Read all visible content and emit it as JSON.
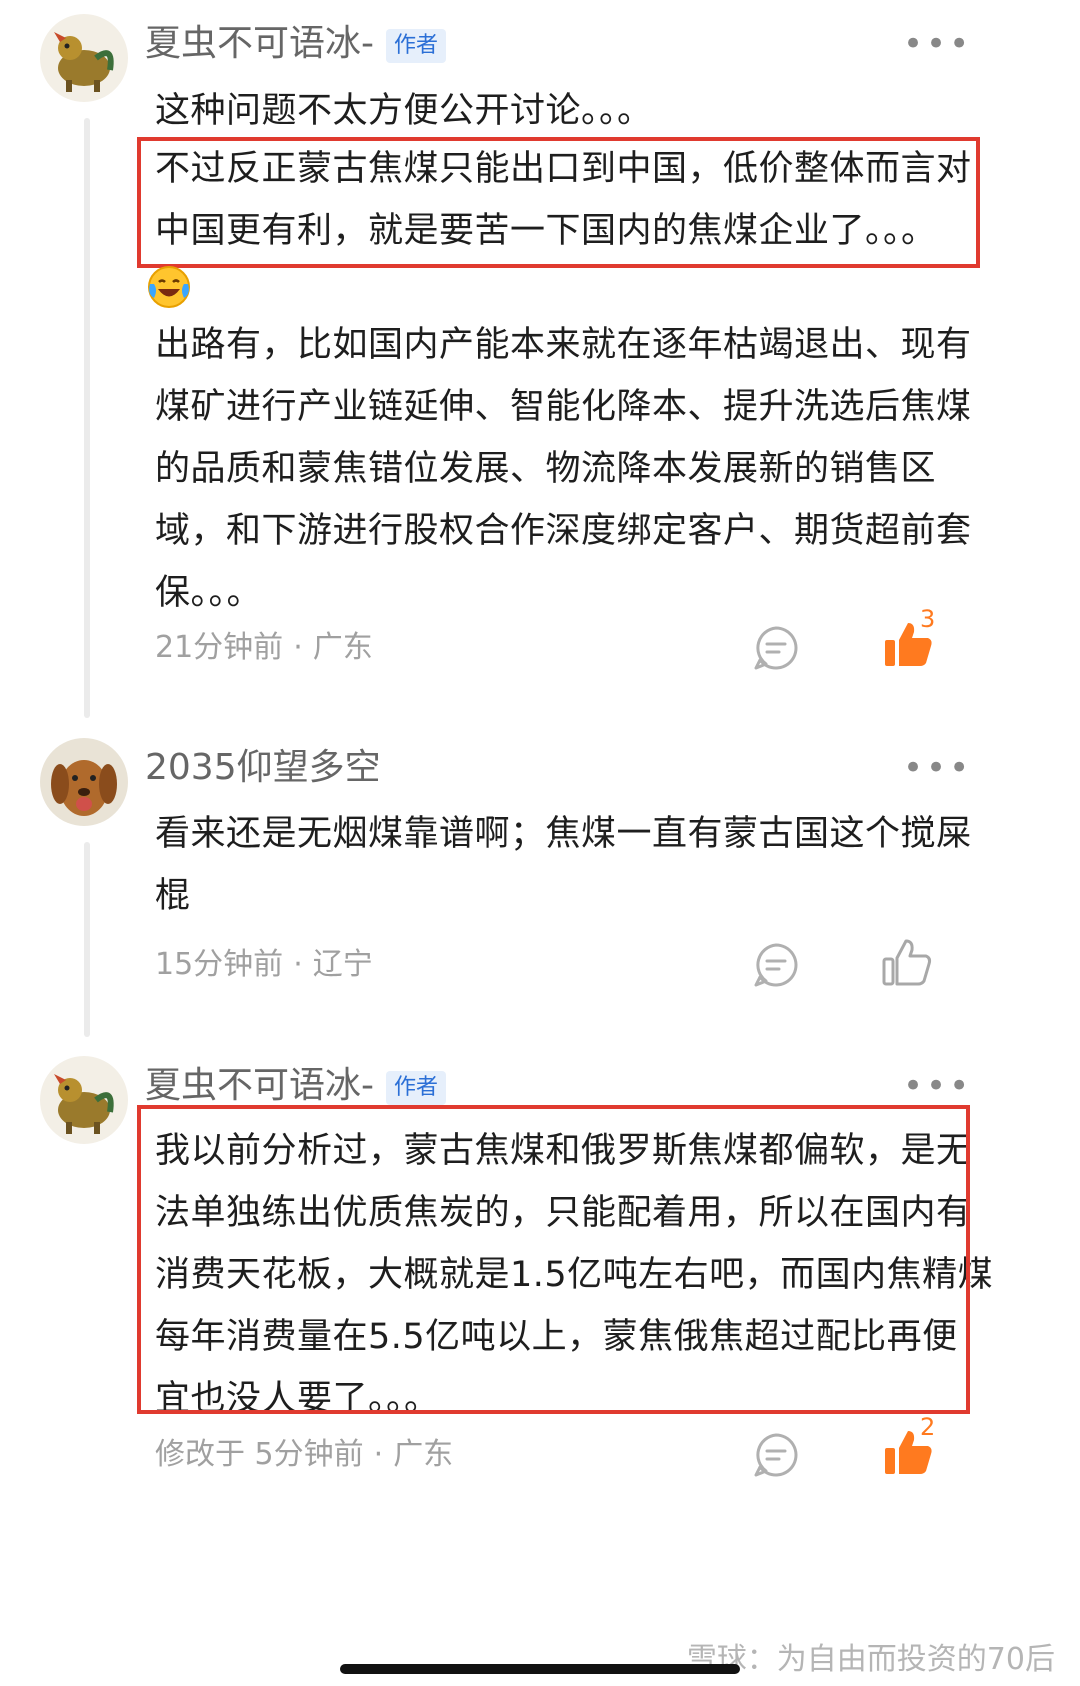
{
  "comments": [
    {
      "author": "夏虫不可语冰-",
      "badge": "作者",
      "more": "•••",
      "lines": [
        "这种问题不太方便公开讨论。。。",
        "不过反正蒙古焦煤只能出口到中国，低价整体而言对",
        "中国更有利，就是要苦一下国内的焦煤企业了。。。",
        "出路有，比如国内产能本来就在逐年枯竭退出、现有",
        "煤矿进行产业链延伸、智能化降本、提升洗选后焦煤",
        "的品质和蒙焦错位发展、物流降本发展新的销售区",
        "域，和下游进行股权合作深度绑定客户、期货超前套",
        "保。。。"
      ],
      "emoji": "laughing-crying-emoji",
      "time": "21分钟前",
      "location": "广东",
      "like_count": "3",
      "liked": true
    },
    {
      "author": "2035仰望多空",
      "more": "•••",
      "lines": [
        "看来还是无烟煤靠谱啊；焦煤一直有蒙古国这个搅屎",
        "棍"
      ],
      "time": "15分钟前",
      "location": "辽宁",
      "like_count": "",
      "liked": false
    },
    {
      "author": "夏虫不可语冰-",
      "badge": "作者",
      "more": "•••",
      "lines": [
        "我以前分析过，蒙古焦煤和俄罗斯焦煤都偏软，是无",
        "法单独练出优质焦炭的，只能配着用，所以在国内有",
        "消费天花板，大概就是1.5亿吨左右吧，而国内焦精煤",
        "每年消费量在5.5亿吨以上，蒙焦俄焦超过配比再便",
        "宜也没人要了。。。"
      ],
      "time_prefix": "修改于",
      "time": "5分钟前",
      "location": "广东",
      "like_count": "2",
      "liked": true
    }
  ],
  "separator": "·",
  "watermark": "雪球：为自由而投资的70后",
  "colors": {
    "highlight": "#e03a2f",
    "like_active": "#ff7a1f",
    "badge_text": "#2b6fd6",
    "meta_text": "#a0a0a0"
  }
}
